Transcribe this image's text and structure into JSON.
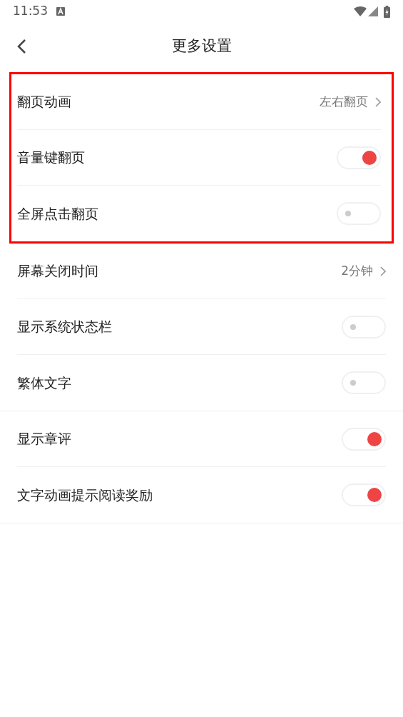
{
  "status_bar": {
    "time": "11:53"
  },
  "header": {
    "title": "更多设置"
  },
  "sections": [
    {
      "highlighted": true,
      "rows": [
        {
          "kind": "link",
          "label": "翻页动画",
          "value": "左右翻页"
        },
        {
          "kind": "toggle",
          "label": "音量键翻页",
          "on": true
        },
        {
          "kind": "toggle",
          "label": "全屏点击翻页",
          "on": false
        }
      ]
    },
    {
      "highlighted": false,
      "rows": [
        {
          "kind": "link",
          "label": "屏幕关闭时间",
          "value": "2分钟"
        },
        {
          "kind": "toggle",
          "label": "显示系统状态栏",
          "on": false
        },
        {
          "kind": "toggle",
          "label": "繁体文字",
          "on": false
        }
      ]
    },
    {
      "highlighted": false,
      "rows": [
        {
          "kind": "toggle",
          "label": "显示章评",
          "on": true
        },
        {
          "kind": "toggle",
          "label": "文字动画提示阅读奖励",
          "on": true
        }
      ]
    }
  ]
}
